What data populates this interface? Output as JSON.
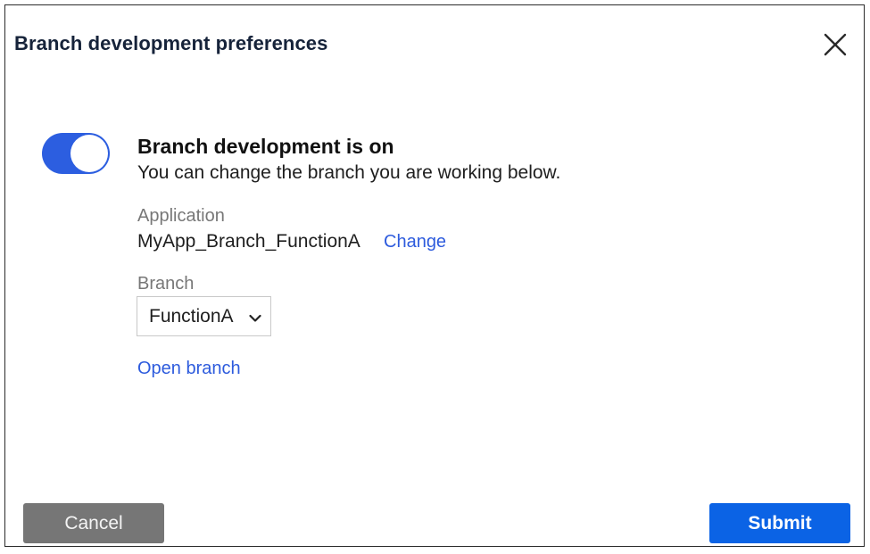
{
  "dialog": {
    "title": "Branch development preferences",
    "close_icon": "close-icon"
  },
  "toggle": {
    "state": "on",
    "color": "#2c5ee0"
  },
  "status": {
    "heading": "Branch development is on",
    "description": "You can change the branch you are working below."
  },
  "application": {
    "label": "Application",
    "value": "MyApp_Branch_FunctionA",
    "change_link": "Change"
  },
  "branch": {
    "label": "Branch",
    "selected": "FunctionA",
    "chevron_icon": "chevron-down-icon",
    "open_link": "Open branch"
  },
  "footer": {
    "cancel_label": "Cancel",
    "submit_label": "Submit",
    "cancel_color": "#767676",
    "submit_color": "#0b63e5"
  },
  "colors": {
    "link": "#2d5bdd",
    "title": "#16233a"
  }
}
